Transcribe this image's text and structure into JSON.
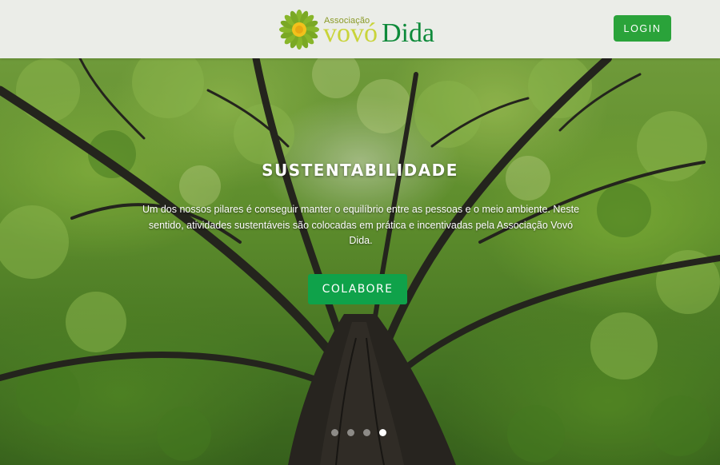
{
  "header": {
    "logo": {
      "small_text": "Associação",
      "name_part1": "vovó",
      "name_part2": "Dida",
      "colors": {
        "petals": "#88b62a",
        "center": "#f2c11b",
        "vovo": "#c9d43a",
        "dida": "#0e8a3a"
      }
    },
    "login_label": "LOGIN"
  },
  "hero": {
    "title": "SUSTENTABILIDADE",
    "description": "Um dos nossos pilares é conseguir manter o equilíbrio entre as pessoas e o meio ambiente. Neste sentido, atividades sustentáveis são colocadas em prática e incentivadas pela Associação Vovó Dida.",
    "cta_label": "COLABORE",
    "image": "tree-canopy-photo",
    "slides": {
      "count": 4,
      "active": 4
    }
  },
  "colors": {
    "accent": "#0fa24a",
    "login_button": "#2aa33a"
  }
}
